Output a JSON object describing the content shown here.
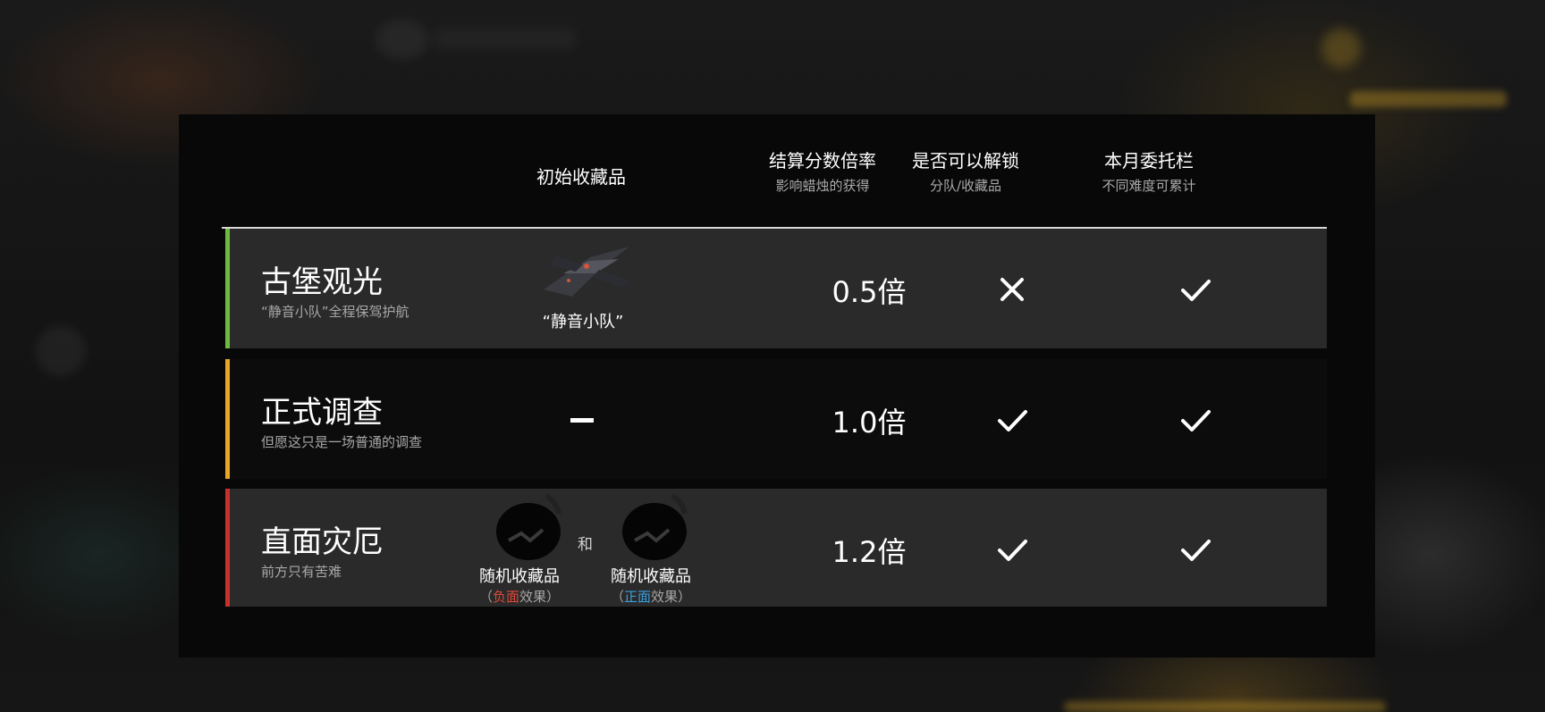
{
  "header": {
    "col_collectible": "初始收藏品",
    "col_multiplier": "结算分数倍率",
    "col_multiplier_sub": "影响蜡烛的获得",
    "col_unlock": "是否可以解锁",
    "col_unlock_sub": "分队/收藏品",
    "col_slot": "本月委托栏",
    "col_slot_sub": "不同难度可累计"
  },
  "rows": [
    {
      "name": "古堡观光",
      "desc": "“静音小队”全程保驾护航",
      "accent": "#6dbb3c",
      "collectible_label": "“静音小队”",
      "multiplier": "0.5倍",
      "unlock": "cross-icon",
      "slot": "check-icon"
    },
    {
      "name": "正式调查",
      "desc": "但愿这只是一场普通的调查",
      "accent": "#e8a623",
      "collectible_label": "–",
      "multiplier": "1.0倍",
      "unlock": "check-icon",
      "slot": "check-icon"
    },
    {
      "name": "直面灾厄",
      "desc": "前方只有苦难",
      "accent": "#c8312b",
      "collectible_a_label": "随机收藏品",
      "collectible_a_open": "（",
      "collectible_a_effect": "负面",
      "collectible_a_close": "效果）",
      "connector": "和",
      "collectible_b_label": "随机收藏品",
      "collectible_b_open": "（",
      "collectible_b_effect": "正面",
      "collectible_b_close": "效果）",
      "multiplier": "1.2倍",
      "unlock": "check-icon",
      "slot": "check-icon"
    }
  ],
  "colors": {
    "negative": "#e04a3a",
    "positive": "#3aa0e0"
  }
}
